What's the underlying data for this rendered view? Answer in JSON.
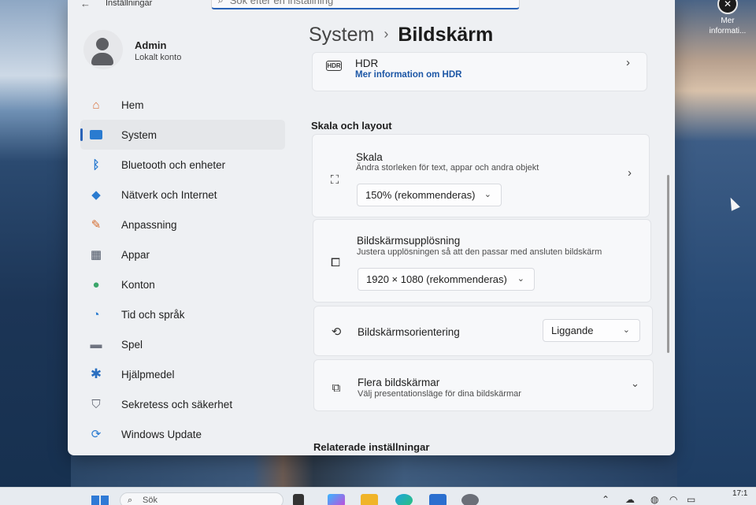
{
  "window": {
    "app_title": "Inställningar",
    "search_placeholder": "Sök efter en inställning"
  },
  "user": {
    "name": "Admin",
    "account_type": "Lokalt konto"
  },
  "sidebar": {
    "items": [
      {
        "label": "Hem",
        "icon": "home-icon",
        "color": "#d9703a"
      },
      {
        "label": "System",
        "icon": "system-icon",
        "color": "#2a7bd0",
        "active": true
      },
      {
        "label": "Bluetooth och enheter",
        "icon": "bluetooth-icon",
        "color": "#2a7bd0"
      },
      {
        "label": "Nätverk och Internet",
        "icon": "wifi-icon",
        "color": "#2a7bd0"
      },
      {
        "label": "Anpassning",
        "icon": "brush-icon",
        "color": "#d46a2c"
      },
      {
        "label": "Appar",
        "icon": "apps-icon",
        "color": "#4a5363"
      },
      {
        "label": "Konton",
        "icon": "accounts-icon",
        "color": "#3aa56a"
      },
      {
        "label": "Tid och språk",
        "icon": "globe-clock-icon",
        "color": "#2a7bd0"
      },
      {
        "label": "Spel",
        "icon": "gamepad-icon",
        "color": "#6f7480"
      },
      {
        "label": "Hjälpmedel",
        "icon": "accessibility-icon",
        "color": "#2a6fc0"
      },
      {
        "label": "Sekretess och säkerhet",
        "icon": "shield-icon",
        "color": "#5f6470"
      },
      {
        "label": "Windows Update",
        "icon": "update-icon",
        "color": "#2a7bd0"
      }
    ]
  },
  "header": {
    "breadcrumb_parent": "System",
    "breadcrumb_sep": "›",
    "breadcrumb_current": "Bildskärm"
  },
  "hdr": {
    "title": "HDR",
    "link": "Mer information om HDR"
  },
  "scale_layout": {
    "section_title": "Skala och layout",
    "scale": {
      "title": "Skala",
      "subtitle": "Ändra storleken för text, appar och andra objekt",
      "value": "150% (rekommenderas)"
    },
    "resolution": {
      "title": "Bildskärmsupplösning",
      "subtitle": "Justera  upplösningen så att den passar med  ansluten bildskärm",
      "value": "1920 × 1080 (rekommenderas)"
    },
    "orientation": {
      "title": "Bildskärmsorientering",
      "value": "Liggande"
    },
    "multiple": {
      "title": "Flera bildskärmar",
      "subtitle": "Välj presentationsläge för dina bildskärmar"
    }
  },
  "related": {
    "section_title": "Relaterade inställningar"
  },
  "desktop": {
    "icon_label_line1": "Mer",
    "icon_label_line2": "informati..."
  },
  "taskbar": {
    "search_placeholder": "Sök",
    "clock": "17:1"
  },
  "colors": {
    "accent": "#2a63b8",
    "link": "#1d57a6"
  }
}
